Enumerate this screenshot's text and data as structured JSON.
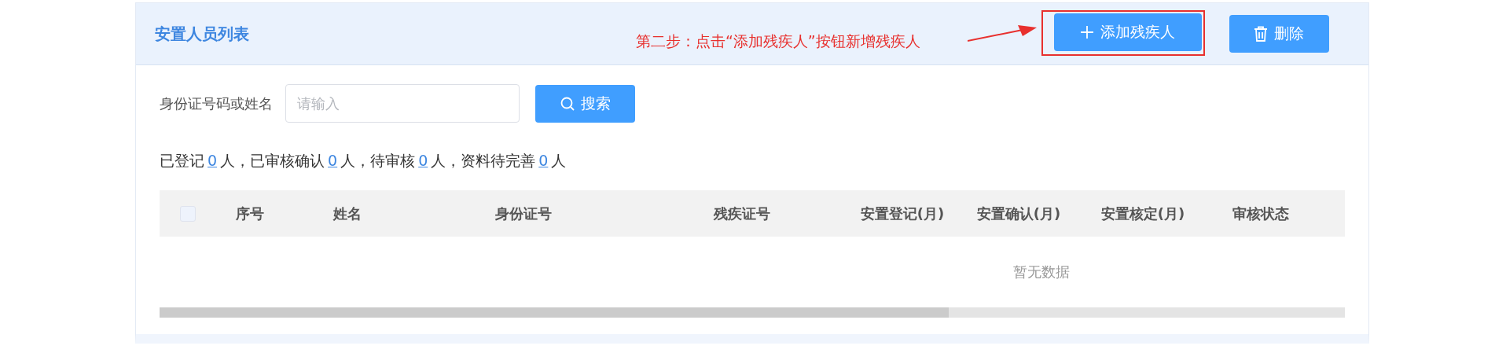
{
  "panel": {
    "title": "安置人员列表",
    "annotation": "第二步：点击“添加残疾人”按钮新增残疾人",
    "buttons": [
      {
        "kind": "add",
        "label": "添加残疾人",
        "highlighted": true
      },
      {
        "kind": "delete",
        "label": "删除",
        "highlighted": false
      }
    ]
  },
  "search": {
    "label": "身份证号码或姓名",
    "placeholder": "请输入",
    "button": "搜索"
  },
  "stats": [
    {
      "label": "已登记",
      "count": "0",
      "suffix": "人，"
    },
    {
      "label": "已审核确认",
      "count": "0",
      "suffix": "人，"
    },
    {
      "label": "待审核",
      "count": "0",
      "suffix": "人，"
    },
    {
      "label": "资料待完善",
      "count": "0",
      "suffix": "人"
    }
  ],
  "table": {
    "select_all": {
      "checked": false
    },
    "columns": [
      "序号",
      "姓名",
      "身份证号",
      "残疾证号",
      "安置登记(月)",
      "安置确认(月)",
      "安置核定(月)",
      "审核状态"
    ],
    "empty_text": "暂无数据"
  }
}
